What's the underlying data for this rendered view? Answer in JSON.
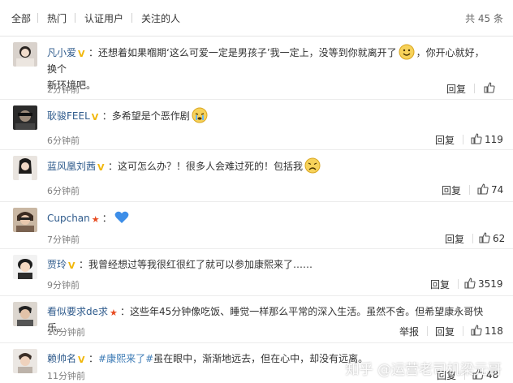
{
  "tabs": [
    {
      "label": "全部"
    },
    {
      "label": "热门"
    },
    {
      "label": "认证用户"
    },
    {
      "label": "关注的人"
    }
  ],
  "total_label": "共 45 条",
  "comments": [
    {
      "user": "凡小爱",
      "text_a": "：还想着如果嗰期‘这么可爱一定是男孩子’我一定上，没等到你就离开了",
      "text_b": "，你开心就好，换个",
      "text_c": "新环境吧。",
      "time": "2分钟前",
      "reply": "回复",
      "likes": "",
      "report": ""
    },
    {
      "user": "耿骏FEEL",
      "text_a": "：多希望是个恶作剧",
      "time": "6分钟前",
      "reply": "回复",
      "likes": "119"
    },
    {
      "user": "蓝风凰刘茜",
      "text_a": "：这可怎么办？！很多人会难过死的！包括我",
      "time": "6分钟前",
      "reply": "回复",
      "likes": "74"
    },
    {
      "user": "Cupchan",
      "text_a": "：",
      "time": "7分钟前",
      "reply": "回复",
      "likes": "62"
    },
    {
      "user": "贾玲",
      "text_a": "：我曾经想过等我很红很红了就可以参加康熙来了……",
      "time": "9分钟前",
      "reply": "回复",
      "likes": "3519"
    },
    {
      "user": "看似要求de求",
      "text_a": "：这些年45分钟像吃饭、睡觉一样那么平常的深入生活。虽然不舍。但希望康永哥快乐。",
      "time": "10分钟前",
      "report": "举报",
      "reply": "回复",
      "likes": "118"
    },
    {
      "user": "赖帅名",
      "hashtag": "#康熙来了#",
      "text_a": "：",
      "text_b": "虽在眼中，渐渐地远去，但在心中，却没有远离。",
      "time": "11分钟前",
      "reply": "回复",
      "likes": "48"
    }
  ],
  "watermark": "知乎 @运营老司机梁元哥",
  "colors": {
    "accent": "#eb7350",
    "link": "#2f5b8c",
    "hashtag": "#3b7ab5",
    "vip": "#f1b70b"
  }
}
